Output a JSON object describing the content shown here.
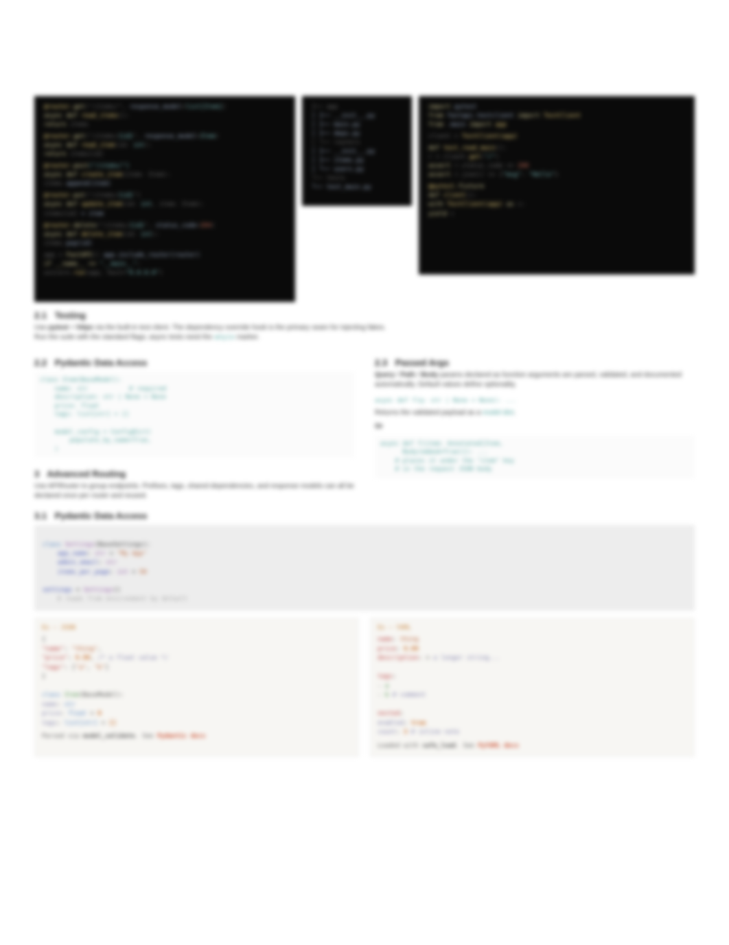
{
  "code_left": {
    "l1a": "@router.",
    "l1b": "get",
    "l1c": "(\"/items/\", ",
    "l1d": "response_model",
    "l1e": "=",
    "l1f": "list[Item]",
    "l1g": ")",
    "l2a": "async def ",
    "l2b": "read_items",
    "l2c": "():",
    "l3a": "    return ",
    "l3b": "items",
    "l4a": "@router.",
    "l4b": "get",
    "l4c": "(\"/items/",
    "l4d": "{id}",
    "l4e": "\", ",
    "l4f": "response_model",
    "l4g": "=",
    "l4h": "Item",
    "l4i": ")",
    "l5a": "async def ",
    "l5b": "read_item",
    "l5c": "(id: ",
    "l5d": "int",
    "l5e": "):",
    "l6a": "    return ",
    "l6b": "items[id]",
    "l7a": "@router.",
    "l7b": "post",
    "l7c": "(\"/items/\")",
    "l8a": "async def ",
    "l8b": "create_item",
    "l8c": "(item: Item):",
    "l9a": "    items.",
    "l9b": "append(item)",
    "l10a": "@router.",
    "l10b": "put",
    "l10c": "(\"/items/",
    "l10d": "{id}",
    "l10e": "\")",
    "l11a": "async def ",
    "l11b": "update_item",
    "l11c": "(id: ",
    "l11d": "int",
    "l11e": ", item: Item):",
    "l12a": "    items[id] ",
    "l12b": "= item",
    "l13a": "@router.",
    "l13b": "delete",
    "l13c": "(\"/items/",
    "l13d": "{id}",
    "l13e": "\", ",
    "l13f": "status_code",
    "l13g": "=",
    "l13h": "204",
    "l13i": ")",
    "l14a": "async def ",
    "l14b": "delete_item",
    "l14c": "(id: ",
    "l14d": "int",
    "l14e": "):",
    "l15a": "    items.",
    "l15b": "pop(id)",
    "l16a": "app = ",
    "l16b": "FastAPI",
    "l16c": "()   ",
    "l16d": "app.include_router(router)",
    "l17a": "if __name__ == ",
    "l17b": "\"__main__\"",
    "l17c": ":",
    "l18a": "    uvicorn.",
    "l18b": "run",
    "l18c": "(app, host=",
    "l18d": "\"0.0.0.0\"",
    "l18e": ")"
  },
  "code_mid": {
    "l1": "├── app",
    "l2": "│   ├── __init__.py",
    "l3": "│   ├── main.py",
    "l4": "│   ├── deps.py",
    "l5": "│   └── routers",
    "l6": "│       ├── __init__.py",
    "l7": "│       ├── items.py",
    "l8": "│       └── users.py",
    "l9": "└── tests",
    "l10": "    └── test_main.py"
  },
  "code_right": {
    "l1a": "import ",
    "l1b": "pytest",
    "l2a": "from ",
    "l2b": "fastapi.testclient ",
    "l2c": "import ",
    "l2d": "TestClient",
    "l3a": "from ",
    "l3b": ".main ",
    "l3c": "import ",
    "l3d": "app",
    "l4a": "client = ",
    "l4b": "TestClient(app)",
    "l5a": "def ",
    "l5b": "test_read_main",
    "l5c": "():",
    "l6a": "    r = client.",
    "l6b": "get",
    "l6c": "(",
    "l6d": "\"/\"",
    "l6e": ")",
    "l7a": "    assert ",
    "l7b": "r.status_code == ",
    "l7c": "200",
    "l8a": "    assert ",
    "l8b": "r.json() == {",
    "l8c": "\"msg\"",
    "l8d": ": ",
    "l8e": "\"Hello\"",
    "l8f": "}",
    "l9a": "@pytest.",
    "l9b": "fixture",
    "l10a": "def ",
    "l10b": "client",
    "l10c": "():",
    "l11a": "    with ",
    "l11b": "TestClient(app) ",
    "l11c": "as ",
    "l11d": "c:",
    "l12a": "        yield ",
    "l12b": "c"
  },
  "s21": {
    "num": "2.1",
    "title": "Testing"
  },
  "s21_body1_a": "Use ",
  "s21_body1_b": "pytest",
  "s21_body1_c": " + ",
  "s21_body1_d": "httpx",
  "s21_body1_e": " via the built-in test client. The dependency override hook is the primary seam for injecting fakes.",
  "s21_body2": "Run the suite with the standard flags; async tests need the",
  "s21_body2_tt": "anyio",
  "s21_body2_b": "marker.",
  "s22": {
    "num": "2.2",
    "title": "Pydantic Data Access"
  },
  "s22_block": "class Item(BaseModel):\n    name: str           # required\n    description: str | None = None\n    price: float\n    tags: list[str] = []\n\n    model_config = ConfigDict(\n        populate_by_name=True,\n    )",
  "s23": {
    "num": "2.3",
    "title": "Passed Args"
  },
  "s23_body_a": "Query",
  "s23_body_b": " / ",
  "s23_body_c": "Path",
  "s23_body_d": " / ",
  "s23_body_e": "Body",
  "s23_body_tail": " params declared as function arguments are parsed, validated, and documented automatically. Default values define optionality.",
  "s23_code": "async def f(q: str | None = None): ...",
  "s23_note_a": "Returns the validated payload as a ",
  "s23_note_b": "model dict",
  "s23_note_tail": ".",
  "s23_more": "Or",
  "s23_block2": "async def f(item: Annotated[Item,\n      Body(embed=True)]): ...\n    # places it under the \"item\" key\n    # in the request JSON body",
  "s3": {
    "num": "3",
    "title": "Advanced Routing"
  },
  "s3_body": "Use APIRouter to group endpoints. Prefixes, tags, shared dependencies, and response models can all be declared once per router and reused.",
  "s31": {
    "num": "3.1",
    "title": "Pydantic Data Access"
  },
  "s31_code": "class Settings(BaseSettings):\n    app_name: str = \"My App\"\n    admin_email: str\n    items_per_page: int = 50\n\nsettings = Settings()\n    # reads from environment by default",
  "left_box": {
    "title": "Ex — JSON",
    "l1": "{",
    "l2a": "  \"name\"",
    "l2b": ": ",
    "l2c": "\"thing\"",
    "l2d": ",",
    "l3a": "  \"price\"",
    "l3b": ": ",
    "l3c": "9.99",
    "l3d": ",   ",
    "l3e": "/* a float value */",
    "l4a": "  \"tags\"",
    "l4b": ": [",
    "l4c": "\"a\"",
    "l4d": ", ",
    "l4e": "\"b\"",
    "l4f": "]",
    "l5": "}",
    "l6": "",
    "l7a": "class ",
    "l7b": "Item",
    "l7c": "(BaseModel):",
    "l8a": "    name",
    "l8b": ": ",
    "l8c": "str",
    "l9a": "    price",
    "l9b": ": ",
    "l9c": "float ",
    "l9d": "= ",
    "l9e": "0",
    "l10a": "    tags",
    "l10b": ": ",
    "l10c": "list[str] ",
    "l10d": "= ",
    "l10e": "[]",
    "foot_a": "Parsed via ",
    "foot_b": "model_validate",
    "foot_c": ". See ",
    "foot_d": "Pydantic docs"
  },
  "right_box": {
    "title": "Ex — YAML",
    "l1a": "name",
    "l1b": ": ",
    "l1c": "thing",
    "l2a": "price",
    "l2b": ": ",
    "l2c": "9.99",
    "l3a": "description",
    "l3b": ": >",
    "l3c": "  a longer string...",
    "l4": "",
    "l5a": "tags",
    "l5b": ":",
    "l6a": "  - ",
    "l6b": "a",
    "l7a": "  - ",
    "l7b": "b    ",
    "l7c": "# comment",
    "l8": "",
    "l9a": "nested",
    "l9b": ":",
    "l10a": "  enabled",
    "l10b": ": ",
    "l10c": "true",
    "l11a": "  count",
    "l11b": ": ",
    "l11c": "3   ",
    "l11d": "# inline note",
    "foot_a": "Loaded with ",
    "foot_b": "safe_load",
    "foot_c": ". See ",
    "foot_d": "PyYAML docs"
  }
}
